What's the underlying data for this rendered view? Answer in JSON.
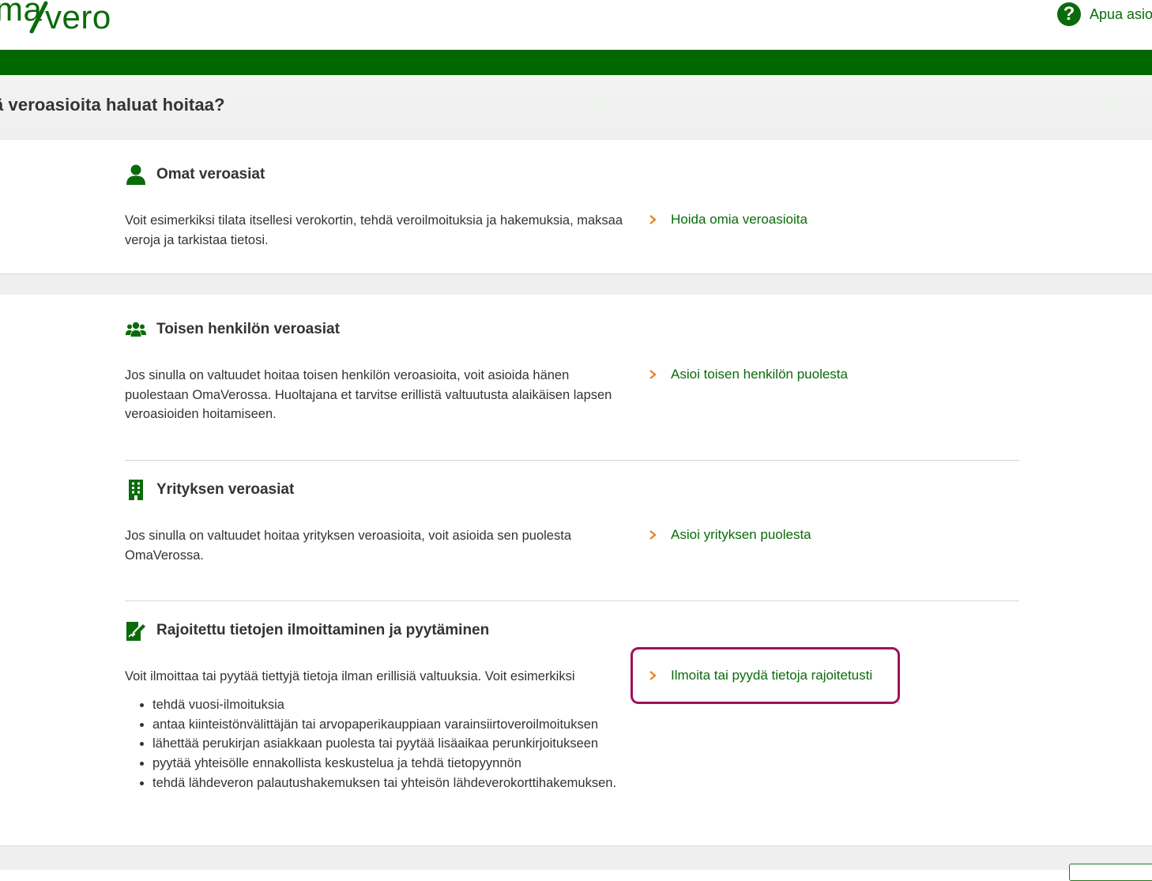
{
  "header": {
    "logo_text_left": "ma",
    "logo_text_right": "vero",
    "help_label": "Apua asioi"
  },
  "question": "ä veroasioita haluat hoitaa?",
  "sections": [
    {
      "title": "Omat veroasiat",
      "icon": "person-icon",
      "description": "Voit esimerkiksi tilata itsellesi verokortin, tehdä veroilmoituksia ja hakemuksia, maksaa veroja ja tarkistaa tietosi.",
      "link": "Hoida omia veroasioita"
    },
    {
      "title": "Toisen henkilön veroasiat",
      "icon": "group-icon",
      "description": "Jos sinulla on valtuudet hoitaa toisen henkilön veroasioita, voit asioida hänen puolestaan OmaVerossa. Huoltajana et tarvitse erillistä valtuutusta alaikäisen lapsen veroasioiden hoitamiseen.",
      "link": "Asioi toisen henkilön puolesta"
    },
    {
      "title": "Yrityksen veroasiat",
      "icon": "building-icon",
      "description": "Jos sinulla on valtuudet hoitaa yrityksen veroasioita, voit asioida sen puolesta OmaVerossa.",
      "link": "Asioi yrityksen puolesta"
    },
    {
      "title": "Rajoitettu tietojen ilmoittaminen ja pyytäminen",
      "icon": "document-edit-icon",
      "description": "Voit ilmoittaa tai pyytää tiettyjä tietoja ilman erillisiä valtuuksia. Voit esimerkiksi",
      "bullets": [
        "tehdä vuosi-ilmoituksia",
        "antaa kiinteistönvälittäjän tai arvopaperikauppiaan varainsiirtoveroilmoituksen",
        "lähettää perukirjan asiakkaan puolesta tai pyytää lisäaikaa perunkirjoitukseen",
        "pyytää yhteisölle ennakollista keskustelua ja tehdä tietopyynnön",
        "tehdä lähdeveron palautushakemuksen tai yhteisön lähdeverokorttihakemuksen."
      ],
      "link": "Ilmoita tai pyydä tietoja rajoitetusti"
    }
  ],
  "colors": {
    "brand_green": "#006600",
    "link_green": "#0a6b0a",
    "chevron_orange": "#e8801e",
    "highlight": "#a0105a"
  }
}
